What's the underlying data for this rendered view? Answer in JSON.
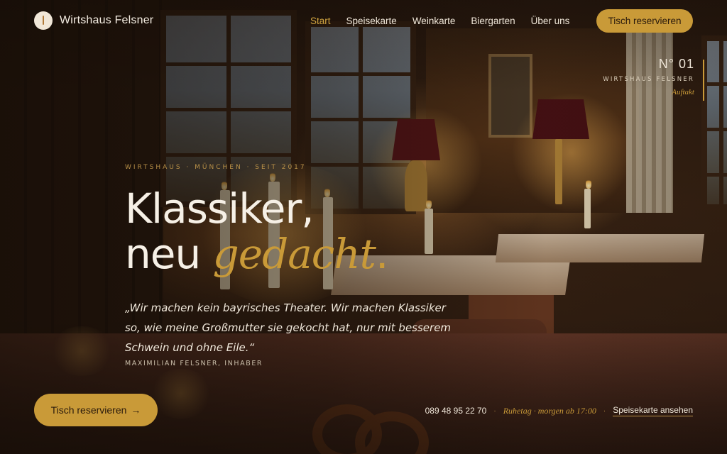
{
  "brand": {
    "name": "Wirtshaus Felsner",
    "icon": "candle-logo-icon"
  },
  "nav": {
    "items": [
      {
        "label": "Start",
        "active": true
      },
      {
        "label": "Speisekarte",
        "active": false
      },
      {
        "label": "Weinkarte",
        "active": false
      },
      {
        "label": "Biergarten",
        "active": false
      },
      {
        "label": "Über uns",
        "active": false
      }
    ],
    "cta_label": "Tisch reservieren"
  },
  "side_label": {
    "number": "N° 01",
    "name": "WIRTSHAUS FELSNER",
    "subtitle": "Auftakt"
  },
  "hero": {
    "eyebrow": "WIRTSHAUS · MÜNCHEN · SEIT 2017",
    "title_line1": "Klassiker,",
    "title_line2_plain": "neu",
    "title_line2_accent": "gedacht",
    "title_end": ".",
    "quote": "„Wir machen kein bayrisches Theater. Wir machen Klassiker so, wie meine Großmutter sie gekocht hat, nur mit besserem Schwein und ohne Eile.“",
    "author": "MAXIMILIAN FELSNER, INHABER"
  },
  "bottom": {
    "cta_label": "Tisch reservieren",
    "cta_arrow": "→",
    "phone": "089 48 95 22 70",
    "hours": "Ruhetag · morgen ab 17:00",
    "menu_link": "Speisekarte ansehen",
    "separator": "·"
  },
  "colors": {
    "accent": "#c99a38",
    "text": "#f4ede2",
    "background": "#1e130c"
  }
}
